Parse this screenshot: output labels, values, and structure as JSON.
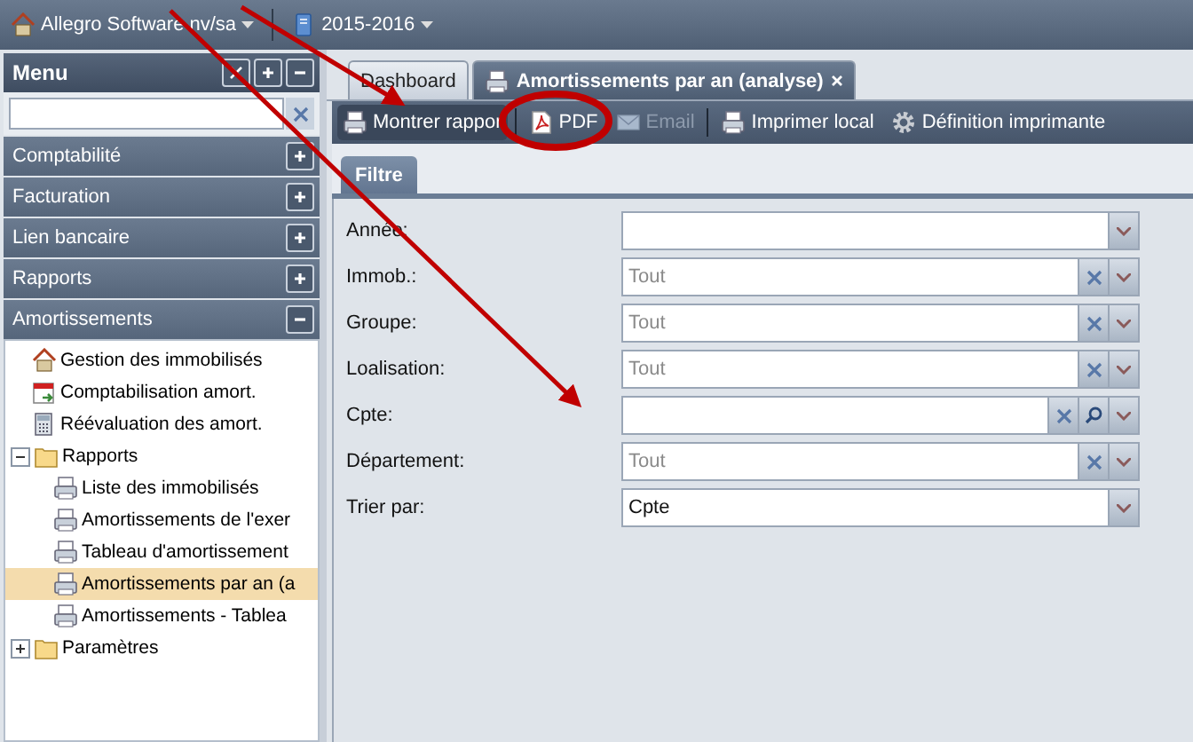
{
  "top_bar": {
    "company": "Allegro Software nv/sa",
    "year": "2015-2016"
  },
  "menu": {
    "title": "Menu",
    "sections": [
      {
        "label": "Comptabilité",
        "expanded": false
      },
      {
        "label": "Facturation",
        "expanded": false
      },
      {
        "label": "Lien bancaire",
        "expanded": false
      },
      {
        "label": "Rapports",
        "expanded": false
      },
      {
        "label": "Amortissements",
        "expanded": true
      }
    ],
    "tree": [
      {
        "label": "Gestion des immobilisés",
        "kind": "house",
        "selected": false
      },
      {
        "label": "Comptabilisation amort.",
        "kind": "calendar",
        "selected": false
      },
      {
        "label": "Réévaluation des amort.",
        "kind": "calculator",
        "selected": false
      },
      {
        "label": "Rapports",
        "kind": "folder",
        "expanded": true,
        "selected": false,
        "children": [
          {
            "label": "Liste des immobilisés",
            "kind": "report",
            "selected": false
          },
          {
            "label": "Amortissements de l'exer",
            "kind": "report",
            "selected": false
          },
          {
            "label": "Tableau d'amortissement",
            "kind": "report",
            "selected": false
          },
          {
            "label": "Amortissements par an (a",
            "kind": "report",
            "selected": true
          },
          {
            "label": "Amortissements - Tablea",
            "kind": "report",
            "selected": false
          }
        ]
      },
      {
        "label": "Paramètres",
        "kind": "folder",
        "expanded": false,
        "selected": false
      }
    ]
  },
  "tabs": [
    {
      "label": "Dashboard",
      "selected": false,
      "closable": false
    },
    {
      "label": "Amortissements par an (analyse)",
      "selected": true,
      "closable": true
    }
  ],
  "toolbar": [
    {
      "label": "Montrer rappor",
      "kind": "report",
      "pressed": true,
      "disabled": false
    },
    {
      "kind": "separator"
    },
    {
      "label": "PDF",
      "kind": "pdf",
      "pressed": false,
      "disabled": false
    },
    {
      "label": "Email",
      "kind": "email",
      "pressed": false,
      "disabled": true
    },
    {
      "kind": "separator"
    },
    {
      "label": "Imprimer local",
      "kind": "print",
      "pressed": false,
      "disabled": false
    },
    {
      "label": "Définition imprimante",
      "kind": "gear",
      "pressed": false,
      "disabled": false
    }
  ],
  "filter_tab": "Filtre",
  "fields": [
    {
      "label": "Année:",
      "clearable": false,
      "searchable": false
    },
    {
      "label": "Immob.:",
      "placeholder": "Tout",
      "clearable": true,
      "searchable": false
    },
    {
      "label": "Groupe:",
      "placeholder": "Tout",
      "clearable": true,
      "searchable": false
    },
    {
      "label": "Loalisation:",
      "placeholder": "Tout",
      "clearable": true,
      "searchable": false
    },
    {
      "label": "Cpte:",
      "clearable": true,
      "searchable": true
    },
    {
      "label": "Département:",
      "placeholder": "Tout",
      "clearable": true,
      "searchable": false
    },
    {
      "label": "Trier par:",
      "value": "Cpte",
      "clearable": false,
      "searchable": false
    }
  ]
}
